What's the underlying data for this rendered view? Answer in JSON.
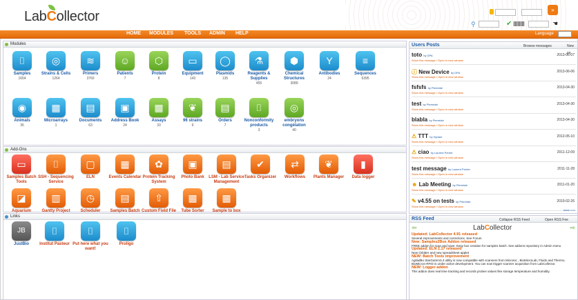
{
  "header": {
    "logo_pre": "Lab",
    "logo_c": "C",
    "logo_post": "ollector"
  },
  "nav": {
    "items": [
      "HOME",
      "MODULES",
      "TOOLS",
      "ADMIN",
      "HELP"
    ],
    "language_label": "Language"
  },
  "modules": {
    "title": "Modules",
    "items": [
      {
        "label": "Samples",
        "count": "1654",
        "icon": "tube-icon",
        "color": "b"
      },
      {
        "label": "Strains & Cells",
        "count": "1264",
        "icon": "cells-icon",
        "color": "b"
      },
      {
        "label": "Primers",
        "count": "3760",
        "icon": "dna-icon",
        "color": "b"
      },
      {
        "label": "Patients",
        "count": "7",
        "icon": "patient-icon",
        "color": "g"
      },
      {
        "label": "Protein",
        "count": "8",
        "icon": "molecule-icon",
        "color": "g"
      },
      {
        "label": "Equipment",
        "count": "143",
        "icon": "monitor-icon",
        "color": "b"
      },
      {
        "label": "Plasmids",
        "count": "135",
        "icon": "plasmid-icon",
        "color": "b"
      },
      {
        "label": "Reagents & Supplies",
        "count": "455",
        "icon": "flask-icon",
        "color": "b"
      },
      {
        "label": "Chemical Structures",
        "count": "3089",
        "icon": "structure-icon",
        "color": "b"
      },
      {
        "label": "Antibodies",
        "count": "24",
        "icon": "antibody-icon",
        "color": "b"
      },
      {
        "label": "Sequences",
        "count": "6395",
        "icon": "sequence-icon",
        "color": "b"
      },
      {
        "label": "Animals",
        "count": "35",
        "icon": "animal-icon",
        "color": "b"
      },
      {
        "label": "Microarrays",
        "count": "1",
        "icon": "grid-icon",
        "color": "b"
      },
      {
        "label": "Documents",
        "count": "63",
        "icon": "document-icon",
        "color": "b"
      },
      {
        "label": "Address Book",
        "count": "24",
        "icon": "address-book-icon",
        "color": "b"
      },
      {
        "label": "Assays",
        "count": "33",
        "icon": "assay-grid-icon",
        "color": "g"
      },
      {
        "label": "96 strains",
        "count": "6",
        "icon": "leaf-icon",
        "color": "g"
      },
      {
        "label": "Orders",
        "count": "7",
        "icon": "orders-icon",
        "color": "g"
      },
      {
        "label": "Nonconformity products",
        "count": "3",
        "icon": "tubes-icon",
        "color": "g"
      },
      {
        "label": "embryons congélation",
        "count": "40",
        "icon": "embryo-icon",
        "color": "g"
      }
    ]
  },
  "addons": {
    "title": "Add-Ons",
    "items": [
      {
        "label": "Samples Batch Tools",
        "icon": "batch-icon",
        "color": "r"
      },
      {
        "label": "SSH - Sequencing Service",
        "icon": "tubes-icon",
        "color": "o"
      },
      {
        "label": "ELN",
        "icon": "notebook-icon",
        "color": "o"
      },
      {
        "label": "Events Calendar",
        "icon": "calendar-icon",
        "color": "o"
      },
      {
        "label": "Protein Tracking System",
        "icon": "protein-icon",
        "color": "o"
      },
      {
        "label": "Photo Bank",
        "icon": "photo-icon",
        "color": "o"
      },
      {
        "label": "LSM - Lab Service Management",
        "icon": "service-icon",
        "color": "o"
      },
      {
        "label": "Tasks Organizer",
        "icon": "check-icon",
        "color": "o"
      },
      {
        "label": "Workflows",
        "icon": "workflow-icon",
        "color": "o"
      },
      {
        "label": "Plants Manager",
        "icon": "plant-icon",
        "color": "o"
      },
      {
        "label": "Data logger",
        "icon": "thermometer-icon",
        "color": "r"
      },
      {
        "label": "Aquarium",
        "icon": "aquarium-icon",
        "color": "o"
      },
      {
        "label": "Gantty Project Manager",
        "icon": "gantt-icon",
        "color": "o"
      },
      {
        "label": "Scheduler",
        "icon": "scheduler-icon",
        "color": "o"
      },
      {
        "label": "Samples Batch Loader",
        "icon": "loader-icon",
        "color": "o"
      },
      {
        "label": "Custom Field File Upload",
        "icon": "upload-icon",
        "color": "o"
      },
      {
        "label": "Tube Sorter",
        "icon": "sorter-icon",
        "color": "o"
      },
      {
        "label": "Sample to box",
        "icon": "box-icon",
        "color": "o"
      }
    ]
  },
  "links": {
    "title": "Links",
    "items": [
      {
        "label": "JustBio",
        "icon": "justbio-logo"
      },
      {
        "label": "Institut Pasteur",
        "icon": "tubes-icon"
      },
      {
        "label": "Put here what you want!",
        "icon": "tubes-icon"
      },
      {
        "label": "Proligo",
        "icon": "tubes-icon"
      }
    ]
  },
  "posts": {
    "title": "Users Posts",
    "browse": "Browse messages",
    "new": "New po",
    "more": "more >>>",
    "msg_link": "Show this message / Open in new window",
    "items": [
      {
        "title": "toto",
        "by": "by DPA",
        "date": "2013-06-07"
      },
      {
        "title": "New Device",
        "by": "by DPA",
        "date": "2013-06-06"
      },
      {
        "title": "fsfsfs",
        "by": "by Pierrelab",
        "date": "2013-04-30"
      },
      {
        "title": "test",
        "by": "by Pierrelab",
        "date": "2013-04-30"
      },
      {
        "title": "blabla",
        "by": "by Pierrelab",
        "date": "2013-04-30"
      },
      {
        "title": "TTT",
        "by": "by Hyriam",
        "date": "2012-05-10"
      },
      {
        "title": "ciao",
        "by": "by Laurent Perrier",
        "date": "2011-12-09"
      },
      {
        "title": "test message",
        "by": "by Laurent Perrier",
        "date": "2011-11-28"
      },
      {
        "title": "Lab Meeting",
        "by": "by Pierrelab",
        "date": "2011-01-20"
      },
      {
        "title": "v4.55 on tests",
        "by": "by Pierrelab",
        "date": "2010-02-26"
      }
    ]
  },
  "rss": {
    "title": "RSS Feed",
    "collapse": "Collapse RSS Feed",
    "open": "Open RSS Fee",
    "items": [
      {
        "t": "Updated: LabCollector 4.91 released",
        "d": "Several improvements and corrections. See Forum"
      },
      {
        "t": "New: Samples2Box Addon released",
        "d": "FREE addon for scan and save. Easy box creation for samples batch. See addons repository in Admin menu"
      },
      {
        "t": "Updated: ELN 2.17 released",
        "d": "New Orbitter and new spreadsheet applet"
      },
      {
        "t": "NEW: Batch Tools improvement",
        "d": "AgiladBo StarGamm3.4 utility is now compatible with scanners from Micronic , BioMicroLab, Fluidx and Thermo. BioMicron RFID is under active development. You can now trigger scanner acquisition from LabCollector."
      },
      {
        "t": "NEW: Logger addon",
        "d": "This addon does real time tracking and records probes values like storage temperature and humidity."
      }
    ]
  },
  "colors": {
    "accent": "#ee7a14",
    "link": "#1a5aa6"
  }
}
